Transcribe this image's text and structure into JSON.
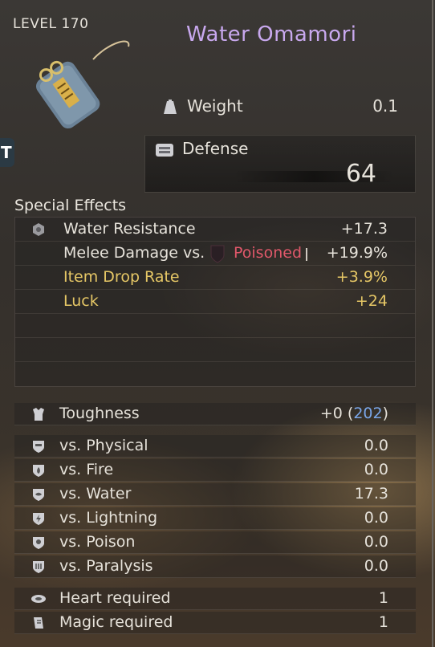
{
  "header": {
    "level": "LEVEL 170",
    "title": "Water Omamori"
  },
  "item": {
    "icon": "omamori-charm-icon",
    "side_tab": "T"
  },
  "weight": {
    "label": "Weight",
    "value": "0.1",
    "icon": "weight-icon"
  },
  "defense": {
    "label": "Defense",
    "value": "64",
    "icon": "armor-icon"
  },
  "special_effects": {
    "title": "Special Effects",
    "rows": [
      {
        "label": "Water Resistance",
        "value": "+17.3",
        "icon": "water-resistance-icon"
      },
      {
        "label": "Melee Damage vs.",
        "status": "Poisoned",
        "value": "+19.9%",
        "icon": "poison-shield-icon"
      },
      {
        "label": "Item Drop Rate",
        "value": "+3.9%"
      },
      {
        "label": "Luck",
        "value": "+24"
      }
    ]
  },
  "toughness": {
    "label": "Toughness",
    "value": "+0",
    "extra": "202",
    "icon": "toughness-icon"
  },
  "resistances": [
    {
      "label": "vs. Physical",
      "value": "0.0",
      "icon": "physical-icon"
    },
    {
      "label": "vs. Fire",
      "value": "0.0",
      "icon": "fire-icon"
    },
    {
      "label": "vs. Water",
      "value": "17.3",
      "icon": "water-icon"
    },
    {
      "label": "vs. Lightning",
      "value": "0.0",
      "icon": "lightning-icon"
    },
    {
      "label": "vs. Poison",
      "value": "0.0",
      "icon": "poison-icon"
    },
    {
      "label": "vs. Paralysis",
      "value": "0.0",
      "icon": "paralysis-icon"
    }
  ],
  "requirements": [
    {
      "label": "Heart required",
      "value": "1",
      "icon": "heart-icon"
    },
    {
      "label": "Magic required",
      "value": "1",
      "icon": "magic-icon"
    }
  ],
  "colors": {
    "title": "#c8a8ee",
    "gold": "#e6c766",
    "poison": "#e0586a",
    "toughness_extra": "#7aa6e8"
  }
}
